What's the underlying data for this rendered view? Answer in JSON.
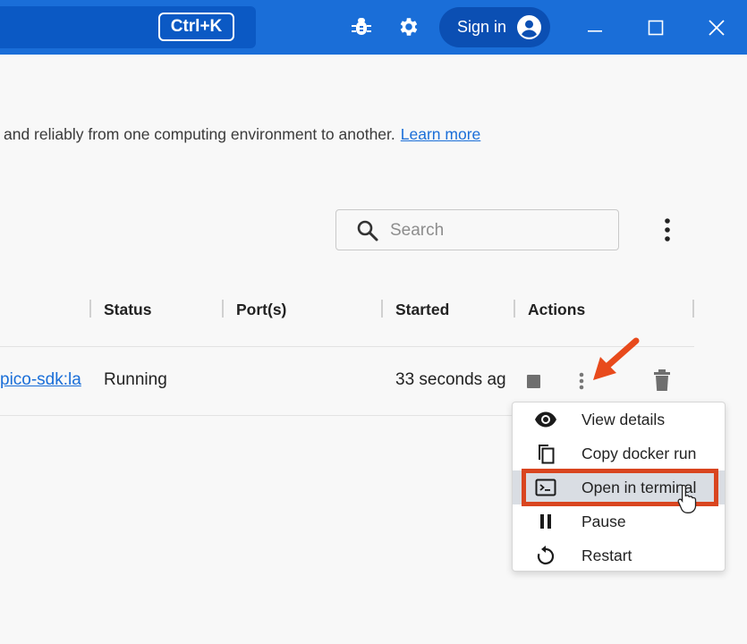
{
  "titlebar": {
    "shortcut": "Ctrl+K",
    "signin_label": "Sign in",
    "icons": [
      "bug-icon",
      "gear-icon",
      "account-icon",
      "minimize-icon",
      "maximize-icon",
      "close-icon"
    ]
  },
  "description": {
    "text": "and reliably from one computing environment to another.",
    "link": "Learn more"
  },
  "search": {
    "placeholder": "Search"
  },
  "table": {
    "columns": [
      "Status",
      "Port(s)",
      "Started",
      "Actions"
    ],
    "rows": [
      {
        "image": "pico-sdk:la",
        "status": "Running",
        "ports": "",
        "started": "33 seconds ag"
      }
    ]
  },
  "menu": {
    "items": [
      {
        "label": "View details",
        "icon": "eye-icon"
      },
      {
        "label": "Copy docker run",
        "icon": "copy-icon"
      },
      {
        "label": "Open in terminal",
        "icon": "terminal-icon"
      },
      {
        "label": "Pause",
        "icon": "pause-icon"
      },
      {
        "label": "Restart",
        "icon": "restart-icon"
      }
    ],
    "highlighted_index": 2
  },
  "colors": {
    "titlebar": "#1a6ed8",
    "accent": "#1a6ed8",
    "annotation": "#d9451f"
  }
}
